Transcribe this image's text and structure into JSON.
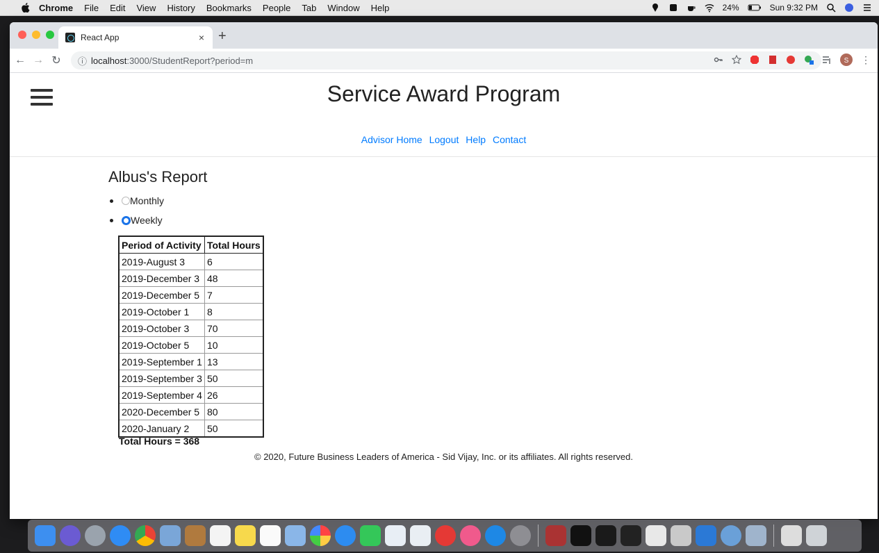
{
  "menubar": {
    "app": "Chrome",
    "items": [
      "File",
      "Edit",
      "View",
      "History",
      "Bookmarks",
      "People",
      "Tab",
      "Window",
      "Help"
    ],
    "battery": "24%",
    "clock": "Sun 9:32 PM"
  },
  "browser": {
    "tab_title": "React App",
    "tab_close": "×",
    "new_tab": "+",
    "url_host": "localhost",
    "url_rest": ":3000/StudentReport?period=m"
  },
  "site": {
    "title": "Service Award Program",
    "nav": [
      "Advisor Home",
      "Logout",
      "Help",
      "Contact"
    ]
  },
  "report": {
    "title": "Albus's Report",
    "options": [
      {
        "label": "Monthly",
        "selected": false
      },
      {
        "label": "Weekly",
        "selected": true
      }
    ],
    "columns": [
      "Period of Activity",
      "Total Hours"
    ],
    "rows": [
      [
        "2019-August 3",
        "6"
      ],
      [
        "2019-December 3",
        "48"
      ],
      [
        "2019-December 5",
        "7"
      ],
      [
        "2019-October 1",
        "8"
      ],
      [
        "2019-October 3",
        "70"
      ],
      [
        "2019-October 5",
        "10"
      ],
      [
        "2019-September 1",
        "13"
      ],
      [
        "2019-September 3",
        "50"
      ],
      [
        "2019-September 4",
        "26"
      ],
      [
        "2020-December 5",
        "80"
      ],
      [
        "2020-January 2",
        "50"
      ]
    ],
    "total": "Total Hours = 368"
  },
  "footer": "© 2020, Future Business Leaders of America - Sid Vijay, Inc. or its affiliates. All rights reserved.",
  "colors": {
    "link": "#007bff",
    "radio_selected": "#1a73e8"
  }
}
